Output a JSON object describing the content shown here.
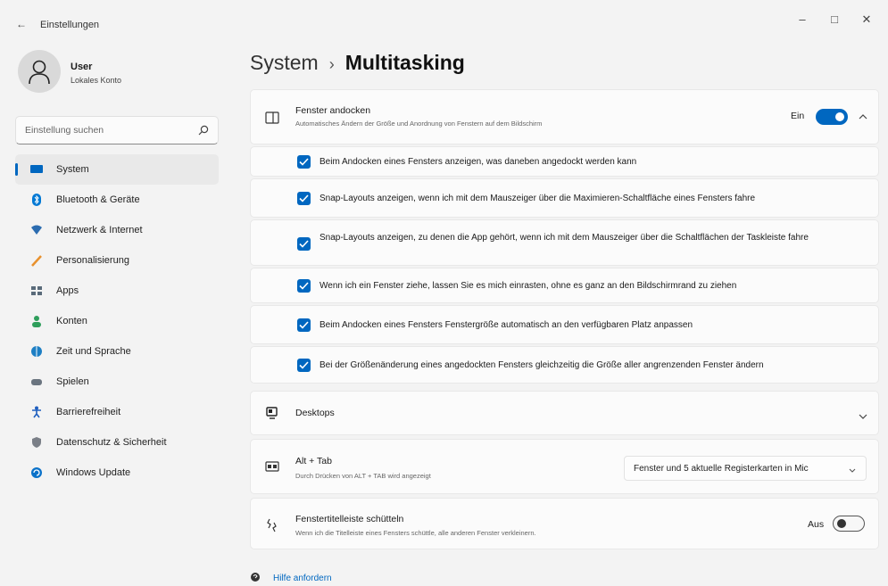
{
  "window": {
    "title": "Einstellungen",
    "back_glyph": "←",
    "minimize": "–",
    "maximize": "□",
    "close": "✕"
  },
  "profile": {
    "name": "User",
    "account": "Lokales Konto"
  },
  "search": {
    "placeholder": "Einstellung suchen"
  },
  "sidebar": {
    "items": [
      {
        "label": "System",
        "icon": "system-icon",
        "color": "#0067c0",
        "active": true
      },
      {
        "label": "Bluetooth & Geräte",
        "icon": "bluetooth-icon",
        "color": "#0078d4"
      },
      {
        "label": "Netzwerk & Internet",
        "icon": "network-icon",
        "color": "#2b6cb0"
      },
      {
        "label": "Personalisierung",
        "icon": "brush-icon",
        "color": "#e8912d"
      },
      {
        "label": "Apps",
        "icon": "apps-icon",
        "color": "#5a6b7a"
      },
      {
        "label": "Konten",
        "icon": "account-icon",
        "color": "#2e9e5b"
      },
      {
        "label": "Zeit und Sprache",
        "icon": "globe-icon",
        "color": "#1d7fc4"
      },
      {
        "label": "Spielen",
        "icon": "gamepad-icon",
        "color": "#6b7580"
      },
      {
        "label": "Barrierefreiheit",
        "icon": "accessibility-icon",
        "color": "#1f5fbf"
      },
      {
        "label": "Datenschutz & Sicherheit",
        "icon": "shield-icon",
        "color": "#7a7f87"
      },
      {
        "label": "Windows Update",
        "icon": "update-icon",
        "color": "#0b72c9"
      }
    ]
  },
  "breadcrumb": {
    "parent": "System",
    "separator": "›",
    "current": "Multitasking"
  },
  "snap": {
    "title": "Fenster andocken",
    "description": "Automatisches Ändern der Größe und Anordnung von Fenstern auf dem Bildschirm",
    "state_label": "Ein",
    "enabled": true,
    "options": [
      "Beim Andocken eines Fensters anzeigen, was daneben angedockt werden kann",
      "Snap-Layouts anzeigen, wenn ich mit dem Mauszeiger über die Maximieren-Schaltfläche eines Fensters fahre",
      "Snap-Layouts anzeigen, zu denen die App gehört, wenn ich mit dem Mauszeiger über die Schaltflächen der Taskleiste fahre",
      "Wenn ich ein Fenster ziehe, lassen Sie es mich einrasten, ohne es ganz an den Bildschirmrand zu ziehen",
      "Beim Andocken eines Fensters Fenstergröße automatisch an den verfügbaren Platz anpassen",
      "Bei der Größenänderung eines angedockten Fensters gleichzeitig die Größe aller angrenzenden Fenster ändern"
    ]
  },
  "desktops": {
    "title": "Desktops"
  },
  "alttab": {
    "title": "Alt + Tab",
    "description": "Durch Drücken von ALT + TAB wird angezeigt",
    "selected": "Fenster und 5 aktuelle Registerkarten in Mic"
  },
  "shake": {
    "title": "Fenstertitelleiste schütteln",
    "description": "Wenn ich die Titelleiste eines Fensters schüttle, alle anderen Fenster verkleinern.",
    "state_label": "Aus",
    "enabled": false
  },
  "help": {
    "label": "Hilfe anfordern"
  },
  "colors": {
    "accent": "#0067c0",
    "background": "#f3f3f3",
    "card": "#fbfbfb"
  }
}
